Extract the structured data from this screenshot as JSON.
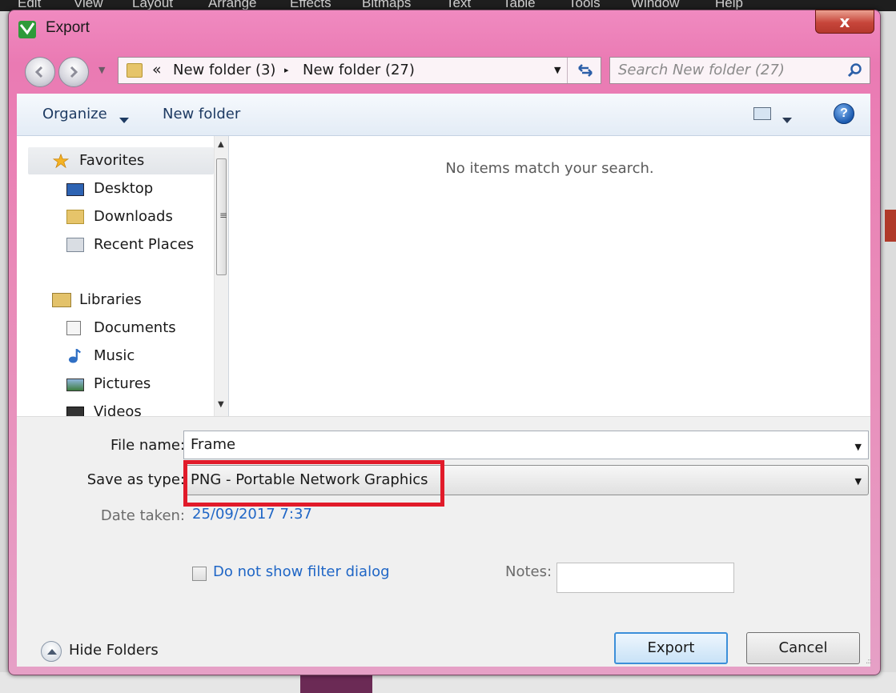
{
  "background_app": {
    "menu": [
      "Edit",
      "View",
      "Layout",
      "Arrange",
      "Effects",
      "Bitmaps",
      "Text",
      "Table",
      "Tools",
      "Window",
      "Help"
    ]
  },
  "dialog": {
    "title": "Export",
    "close_glyph": "x"
  },
  "address": {
    "overflow_chevron": "«",
    "crumbs": [
      "New folder (3)",
      "New folder (27)"
    ],
    "separator": "▸"
  },
  "search": {
    "placeholder": "Search New folder (27)"
  },
  "toolbar": {
    "organize_label": "Organize",
    "new_folder_label": "New folder",
    "help_glyph": "?"
  },
  "nav_pane": {
    "favorites": {
      "label": "Favorites",
      "items": [
        "Desktop",
        "Downloads",
        "Recent Places"
      ]
    },
    "libraries": {
      "label": "Libraries",
      "items": [
        "Documents",
        "Music",
        "Pictures",
        "Videos"
      ]
    }
  },
  "content": {
    "empty_message": "No items match your search."
  },
  "form": {
    "file_name_label": "File name:",
    "file_name_value": "Frame",
    "save_as_type_label": "Save as type:",
    "save_as_type_value": "PNG - Portable Network Graphics",
    "date_taken_label": "Date taken:",
    "date_taken_value": "25/09/2017 7:37",
    "filter_checkbox_label": "Do not show filter dialog",
    "filter_checkbox_checked": false,
    "notes_label": "Notes:",
    "notes_value": ""
  },
  "footer": {
    "hide_folders_label": "Hide Folders",
    "export_label": "Export",
    "cancel_label": "Cancel"
  },
  "colors": {
    "dialog_frame": "#ea7ab3",
    "link_blue": "#1f66c6",
    "highlight_red": "#e11b2a",
    "close_red": "#c7453a"
  },
  "icons": {
    "app": "coreldraw-logo-icon",
    "back": "back-arrow-icon",
    "forward": "forward-arrow-icon",
    "refresh": "refresh-icon",
    "search": "search-icon",
    "views": "change-view-icon",
    "help": "help-icon"
  }
}
